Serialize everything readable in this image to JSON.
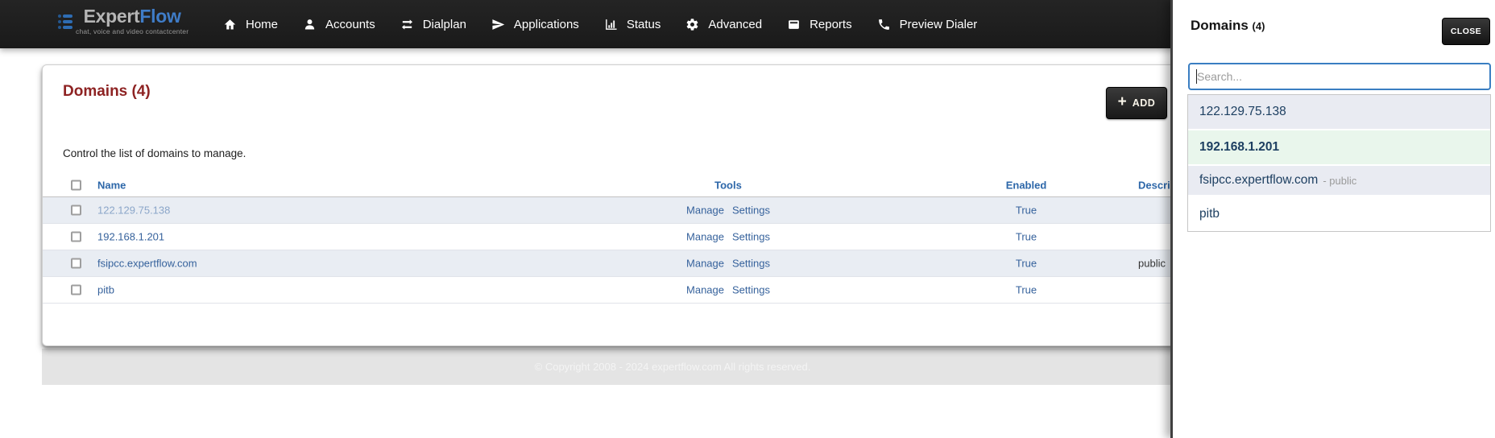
{
  "colors": {
    "nav_bg": "#1f1f1f",
    "brand_blue": "#3f7cc7",
    "heading_red": "#8e2323",
    "link_blue": "#36629c",
    "table_header_blue": "#2d67a9",
    "row_stripe": "#e9edf3",
    "panel_item_bg": "#e9ebf2",
    "selected_green": "#e9f6ec",
    "dark_button": "#222222",
    "search_border_blue": "#3a7ec2"
  },
  "brand": {
    "name_primary": "Expert",
    "name_secondary": "Flow",
    "tagline": "chat, voice and video contactcenter"
  },
  "nav": {
    "items": [
      {
        "label": "Home",
        "icon": "home-icon"
      },
      {
        "label": "Accounts",
        "icon": "person-icon"
      },
      {
        "label": "Dialplan",
        "icon": "swap-arrows-icon"
      },
      {
        "label": "Applications",
        "icon": "paper-plane-icon"
      },
      {
        "label": "Status",
        "icon": "bar-chart-icon"
      },
      {
        "label": "Advanced",
        "icon": "gear-icon"
      },
      {
        "label": "Reports",
        "icon": "drive-icon"
      },
      {
        "label": "Preview Dialer",
        "icon": "phone-icon"
      }
    ]
  },
  "main": {
    "heading": "Domains (4)",
    "subtitle": "Control the list of domains to manage.",
    "add_button": {
      "plus": "+",
      "label": "ADD"
    },
    "table": {
      "headers": [
        "Name",
        "Tools",
        "Enabled",
        "Description"
      ],
      "rows": [
        {
          "name": "122.129.75.138",
          "tools": [
            "Manage",
            "Settings"
          ],
          "enabled": "True",
          "description": ""
        },
        {
          "name": "192.168.1.201",
          "tools": [
            "Manage",
            "Settings"
          ],
          "enabled": "True",
          "description": ""
        },
        {
          "name": "fsipcc.expertflow.com",
          "tools": [
            "Manage",
            "Settings"
          ],
          "enabled": "True",
          "description": "public"
        },
        {
          "name": "pitb",
          "tools": [
            "Manage",
            "Settings"
          ],
          "enabled": "True",
          "description": ""
        }
      ]
    }
  },
  "footer": {
    "copyright": "© Copyright 2008 - 2024 expertflow.com All rights reserved."
  },
  "panel": {
    "title": "Domains",
    "count": "(4)",
    "close_label": "CLOSE",
    "search_placeholder": "Search...",
    "items": [
      {
        "label": "122.129.75.138",
        "suffix": ""
      },
      {
        "label": "192.168.1.201",
        "suffix": ""
      },
      {
        "label": "fsipcc.expertflow.com",
        "suffix": "- public"
      },
      {
        "label": "pitb",
        "suffix": ""
      }
    ]
  }
}
